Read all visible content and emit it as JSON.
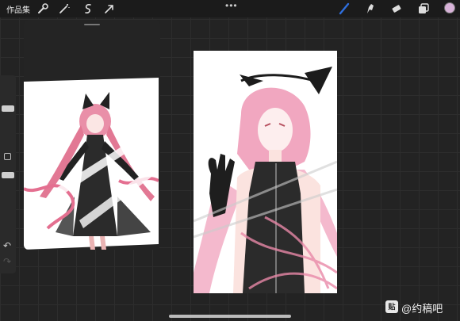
{
  "app": {
    "gallery_label": "作品集",
    "more_menu": "•••"
  },
  "toolbar": {
    "left_tools": [
      "wrench-icon",
      "magic-wand-icon",
      "selection-icon",
      "transform-arrow-icon"
    ],
    "right_tools": [
      "brush-icon",
      "smudge-icon",
      "eraser-icon",
      "layers-icon"
    ],
    "active_tool": "brush-icon",
    "active_color": "#d7b2d8",
    "accent_color": "#2f6fde"
  },
  "sidebar": {
    "undo_label": "↶",
    "redo_label": "↷"
  },
  "reference_panel": {
    "title": ""
  },
  "watermark": {
    "icon_text": "贴",
    "text": "@约稿吧"
  }
}
